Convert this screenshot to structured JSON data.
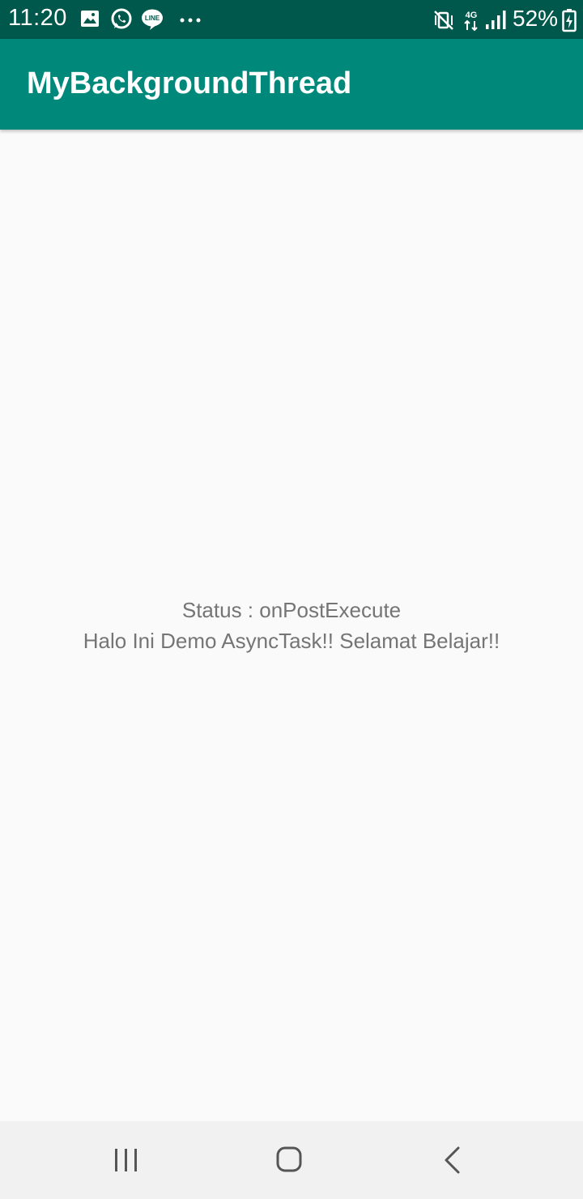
{
  "status_bar": {
    "time": "11:20",
    "battery": "52%",
    "network": "4G",
    "left_icons": [
      "gallery-icon",
      "whatsapp-icon",
      "line-icon",
      "more-dots-icon"
    ],
    "right_icons": [
      "mute-vibrate-icon",
      "4g-data-icon",
      "signal-icon",
      "battery-icon"
    ],
    "background_color": "#00574b"
  },
  "app_bar": {
    "title": "MyBackgroundThread",
    "background_color": "#00897b"
  },
  "content": {
    "status_line": "Status : onPostExecute",
    "message_line": "Halo Ini Demo AsyncTask!! Selamat Belajar!!",
    "text_color": "#757575"
  },
  "nav_bar": {
    "buttons": [
      "recents-icon",
      "home-icon",
      "back-icon"
    ]
  }
}
